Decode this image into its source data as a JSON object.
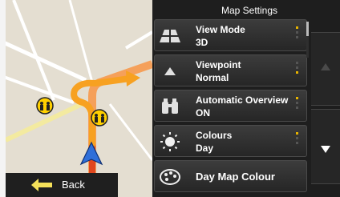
{
  "map_panel": {
    "back_label": "Back"
  },
  "settings": {
    "title": "Map Settings",
    "items": [
      {
        "label": "View Mode",
        "value": "3D",
        "icon": "view-mode-3d-icon"
      },
      {
        "label": "Viewpoint",
        "value": "Normal",
        "icon": "viewpoint-icon"
      },
      {
        "label": "Automatic Overview",
        "value": "ON",
        "icon": "binoculars-icon"
      },
      {
        "label": "Colours",
        "value": "Day",
        "icon": "sun-icon"
      },
      {
        "label": "Day Map Colour",
        "icon": "palette-icon"
      }
    ]
  },
  "scrollbar": {
    "up_icon": "triangle-up-icon",
    "down_icon": "triangle-down-icon"
  },
  "colors": {
    "accent": "#e8b400",
    "route": "#f5821f",
    "vehicle": "#2f6fd9",
    "panel_bg": "#1e1e1e"
  }
}
